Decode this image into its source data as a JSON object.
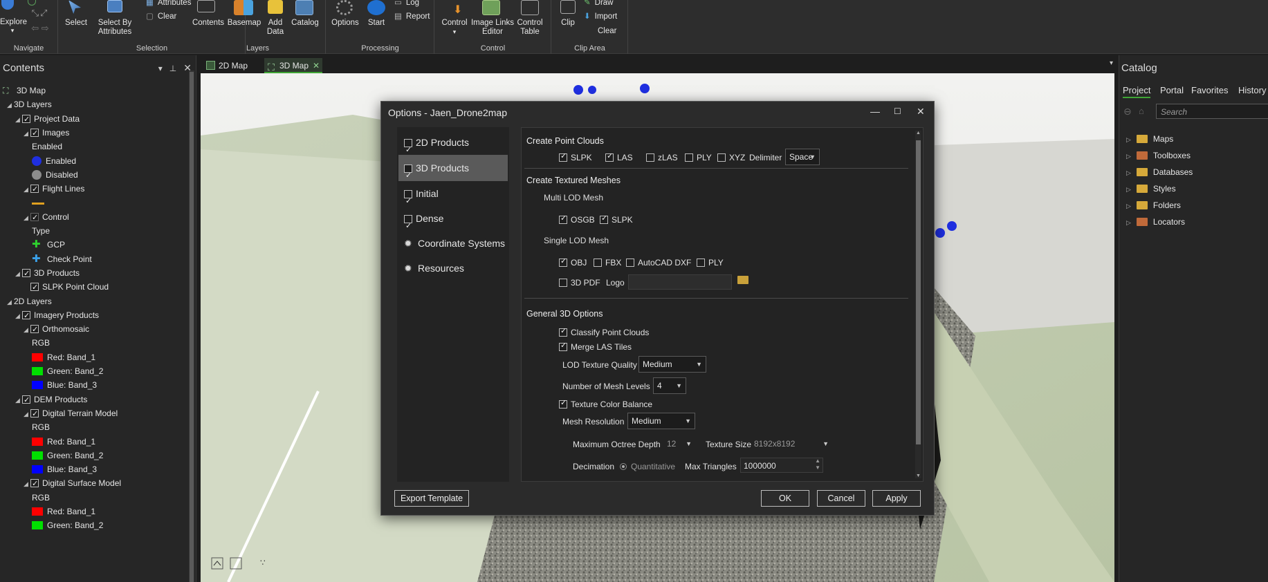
{
  "ribbon": {
    "navigate": {
      "label": "Navigate",
      "explore": "Explore"
    },
    "selection": {
      "label": "Selection",
      "select": "Select",
      "select_by_attributes": "Select By Attributes",
      "attributes": "Attributes",
      "clear": "Clear"
    },
    "layers": {
      "label": "Layers",
      "contents": "Contents",
      "basemap": "Basemap",
      "add_data": "Add Data",
      "catalog": "Catalog"
    },
    "processing": {
      "label": "Processing",
      "options": "Options",
      "start": "Start",
      "log": "Log",
      "report": "Report"
    },
    "control": {
      "label": "Control",
      "control": "Control",
      "image_links_editor": "Image Links Editor",
      "control_table": "Control Table"
    },
    "clip_area": {
      "label": "Clip Area",
      "clip": "Clip",
      "draw": "Draw",
      "import": "Import",
      "clear": "Clear"
    }
  },
  "contents": {
    "title": "Contents",
    "items": [
      {
        "label": "3D Map",
        "level": 0,
        "type": "map"
      },
      {
        "label": "3D Layers",
        "level": 1,
        "type": "group"
      },
      {
        "label": "Project Data",
        "level": 2,
        "type": "check"
      },
      {
        "label": "Images",
        "level": 3,
        "type": "check"
      },
      {
        "label": "Enabled",
        "level": 4,
        "type": "text"
      },
      {
        "label": "Enabled",
        "level": 4,
        "type": "dot",
        "color": "#1f2fe0"
      },
      {
        "label": "Disabled",
        "level": 4,
        "type": "dot",
        "color": "#8c8c8c"
      },
      {
        "label": "Flight Lines",
        "level": 3,
        "type": "check"
      },
      {
        "label": "",
        "level": 4,
        "type": "line",
        "color": "#e0a020"
      },
      {
        "label": "Control",
        "level": 3,
        "type": "check-dim"
      },
      {
        "label": "Type",
        "level": 4,
        "type": "text"
      },
      {
        "label": "GCP",
        "level": 4,
        "type": "plus",
        "color": "#2ed12e"
      },
      {
        "label": "Check Point",
        "level": 4,
        "type": "plus",
        "color": "#3aa0e8"
      },
      {
        "label": "3D Products",
        "level": 2,
        "type": "check"
      },
      {
        "label": "SLPK Point Cloud",
        "level": 3,
        "type": "check-noexp"
      },
      {
        "label": "2D Layers",
        "level": 1,
        "type": "group"
      },
      {
        "label": "Imagery Products",
        "level": 2,
        "type": "check"
      },
      {
        "label": "Orthomosaic",
        "level": 3,
        "type": "check"
      },
      {
        "label": "RGB",
        "level": 4,
        "type": "text"
      },
      {
        "label": "Red:   Band_1",
        "level": 4,
        "type": "swatch",
        "color": "#ff0000"
      },
      {
        "label": "Green: Band_2",
        "level": 4,
        "type": "swatch",
        "color": "#00e000"
      },
      {
        "label": "Blue:  Band_3",
        "level": 4,
        "type": "swatch",
        "color": "#0000ff"
      },
      {
        "label": "DEM Products",
        "level": 2,
        "type": "check"
      },
      {
        "label": "Digital Terrain Model",
        "level": 3,
        "type": "check"
      },
      {
        "label": "RGB",
        "level": 4,
        "type": "text"
      },
      {
        "label": "Red:   Band_1",
        "level": 4,
        "type": "swatch",
        "color": "#ff0000"
      },
      {
        "label": "Green: Band_2",
        "level": 4,
        "type": "swatch",
        "color": "#00e000"
      },
      {
        "label": "Blue:  Band_3",
        "level": 4,
        "type": "swatch",
        "color": "#0000ff"
      },
      {
        "label": "Digital Surface Model",
        "level": 3,
        "type": "check"
      },
      {
        "label": "RGB",
        "level": 4,
        "type": "text"
      },
      {
        "label": "Red:   Band_1",
        "level": 4,
        "type": "swatch",
        "color": "#ff0000"
      },
      {
        "label": "Green: Band_2",
        "level": 4,
        "type": "swatch",
        "color": "#00e000"
      }
    ]
  },
  "map_tabs": [
    {
      "label": "2D Map",
      "active": false
    },
    {
      "label": "3D Map",
      "active": true
    }
  ],
  "catalog": {
    "title": "Catalog",
    "tabs": [
      "Project",
      "Portal",
      "Favorites",
      "History"
    ],
    "search_placeholder": "Search",
    "items": [
      "Maps",
      "Toolboxes",
      "Databases",
      "Styles",
      "Folders",
      "Locators"
    ]
  },
  "dialog": {
    "title": "Options - Jaen_Drone2map",
    "nav": [
      {
        "label": "2D Products",
        "kind": "check",
        "active": false
      },
      {
        "label": "3D Products",
        "kind": "check",
        "active": true
      },
      {
        "label": "Initial",
        "kind": "check",
        "active": false
      },
      {
        "label": "Dense",
        "kind": "check",
        "active": false
      },
      {
        "label": "Coordinate Systems",
        "kind": "gear",
        "active": false
      },
      {
        "label": "Resources",
        "kind": "gear",
        "active": false
      }
    ],
    "point_clouds": {
      "heading": "Create Point Clouds",
      "slpk": "SLPK",
      "las": "LAS",
      "zlas": "zLAS",
      "ply": "PLY",
      "xyz": "XYZ",
      "delimiter_label": "Delimiter",
      "delimiter_value": "Space"
    },
    "meshes": {
      "heading": "Create Textured Meshes",
      "multi_lod": "Multi LOD Mesh",
      "osgb": "OSGB",
      "slpk": "SLPK",
      "single_lod": "Single LOD Mesh",
      "obj": "OBJ",
      "fbx": "FBX",
      "autocad": "AutoCAD DXF",
      "ply": "PLY",
      "pdf3d": "3D PDF",
      "logo_label": "Logo"
    },
    "general": {
      "heading": "General 3D Options",
      "classify": "Classify Point Clouds",
      "merge": "Merge LAS Tiles",
      "lod_quality_label": "LOD Texture Quality",
      "lod_quality_value": "Medium",
      "mesh_levels_label": "Number of Mesh Levels",
      "mesh_levels_value": "4",
      "color_balance": "Texture Color Balance",
      "mesh_res_label": "Mesh Resolution",
      "mesh_res_value": "Medium",
      "octree_label": "Maximum Octree Depth",
      "octree_value": "12",
      "texture_label": "Texture Size",
      "texture_value": "8192x8192",
      "decimation_label": "Decimation",
      "decimation_value": "Quantitative",
      "max_tri_label": "Max Triangles",
      "max_tri_value": "1000000"
    },
    "buttons": {
      "export": "Export Template",
      "ok": "OK",
      "cancel": "Cancel",
      "apply": "Apply"
    }
  },
  "colors": {
    "accent_green": "#3fa535",
    "point_blue": "#1f2fe0"
  }
}
